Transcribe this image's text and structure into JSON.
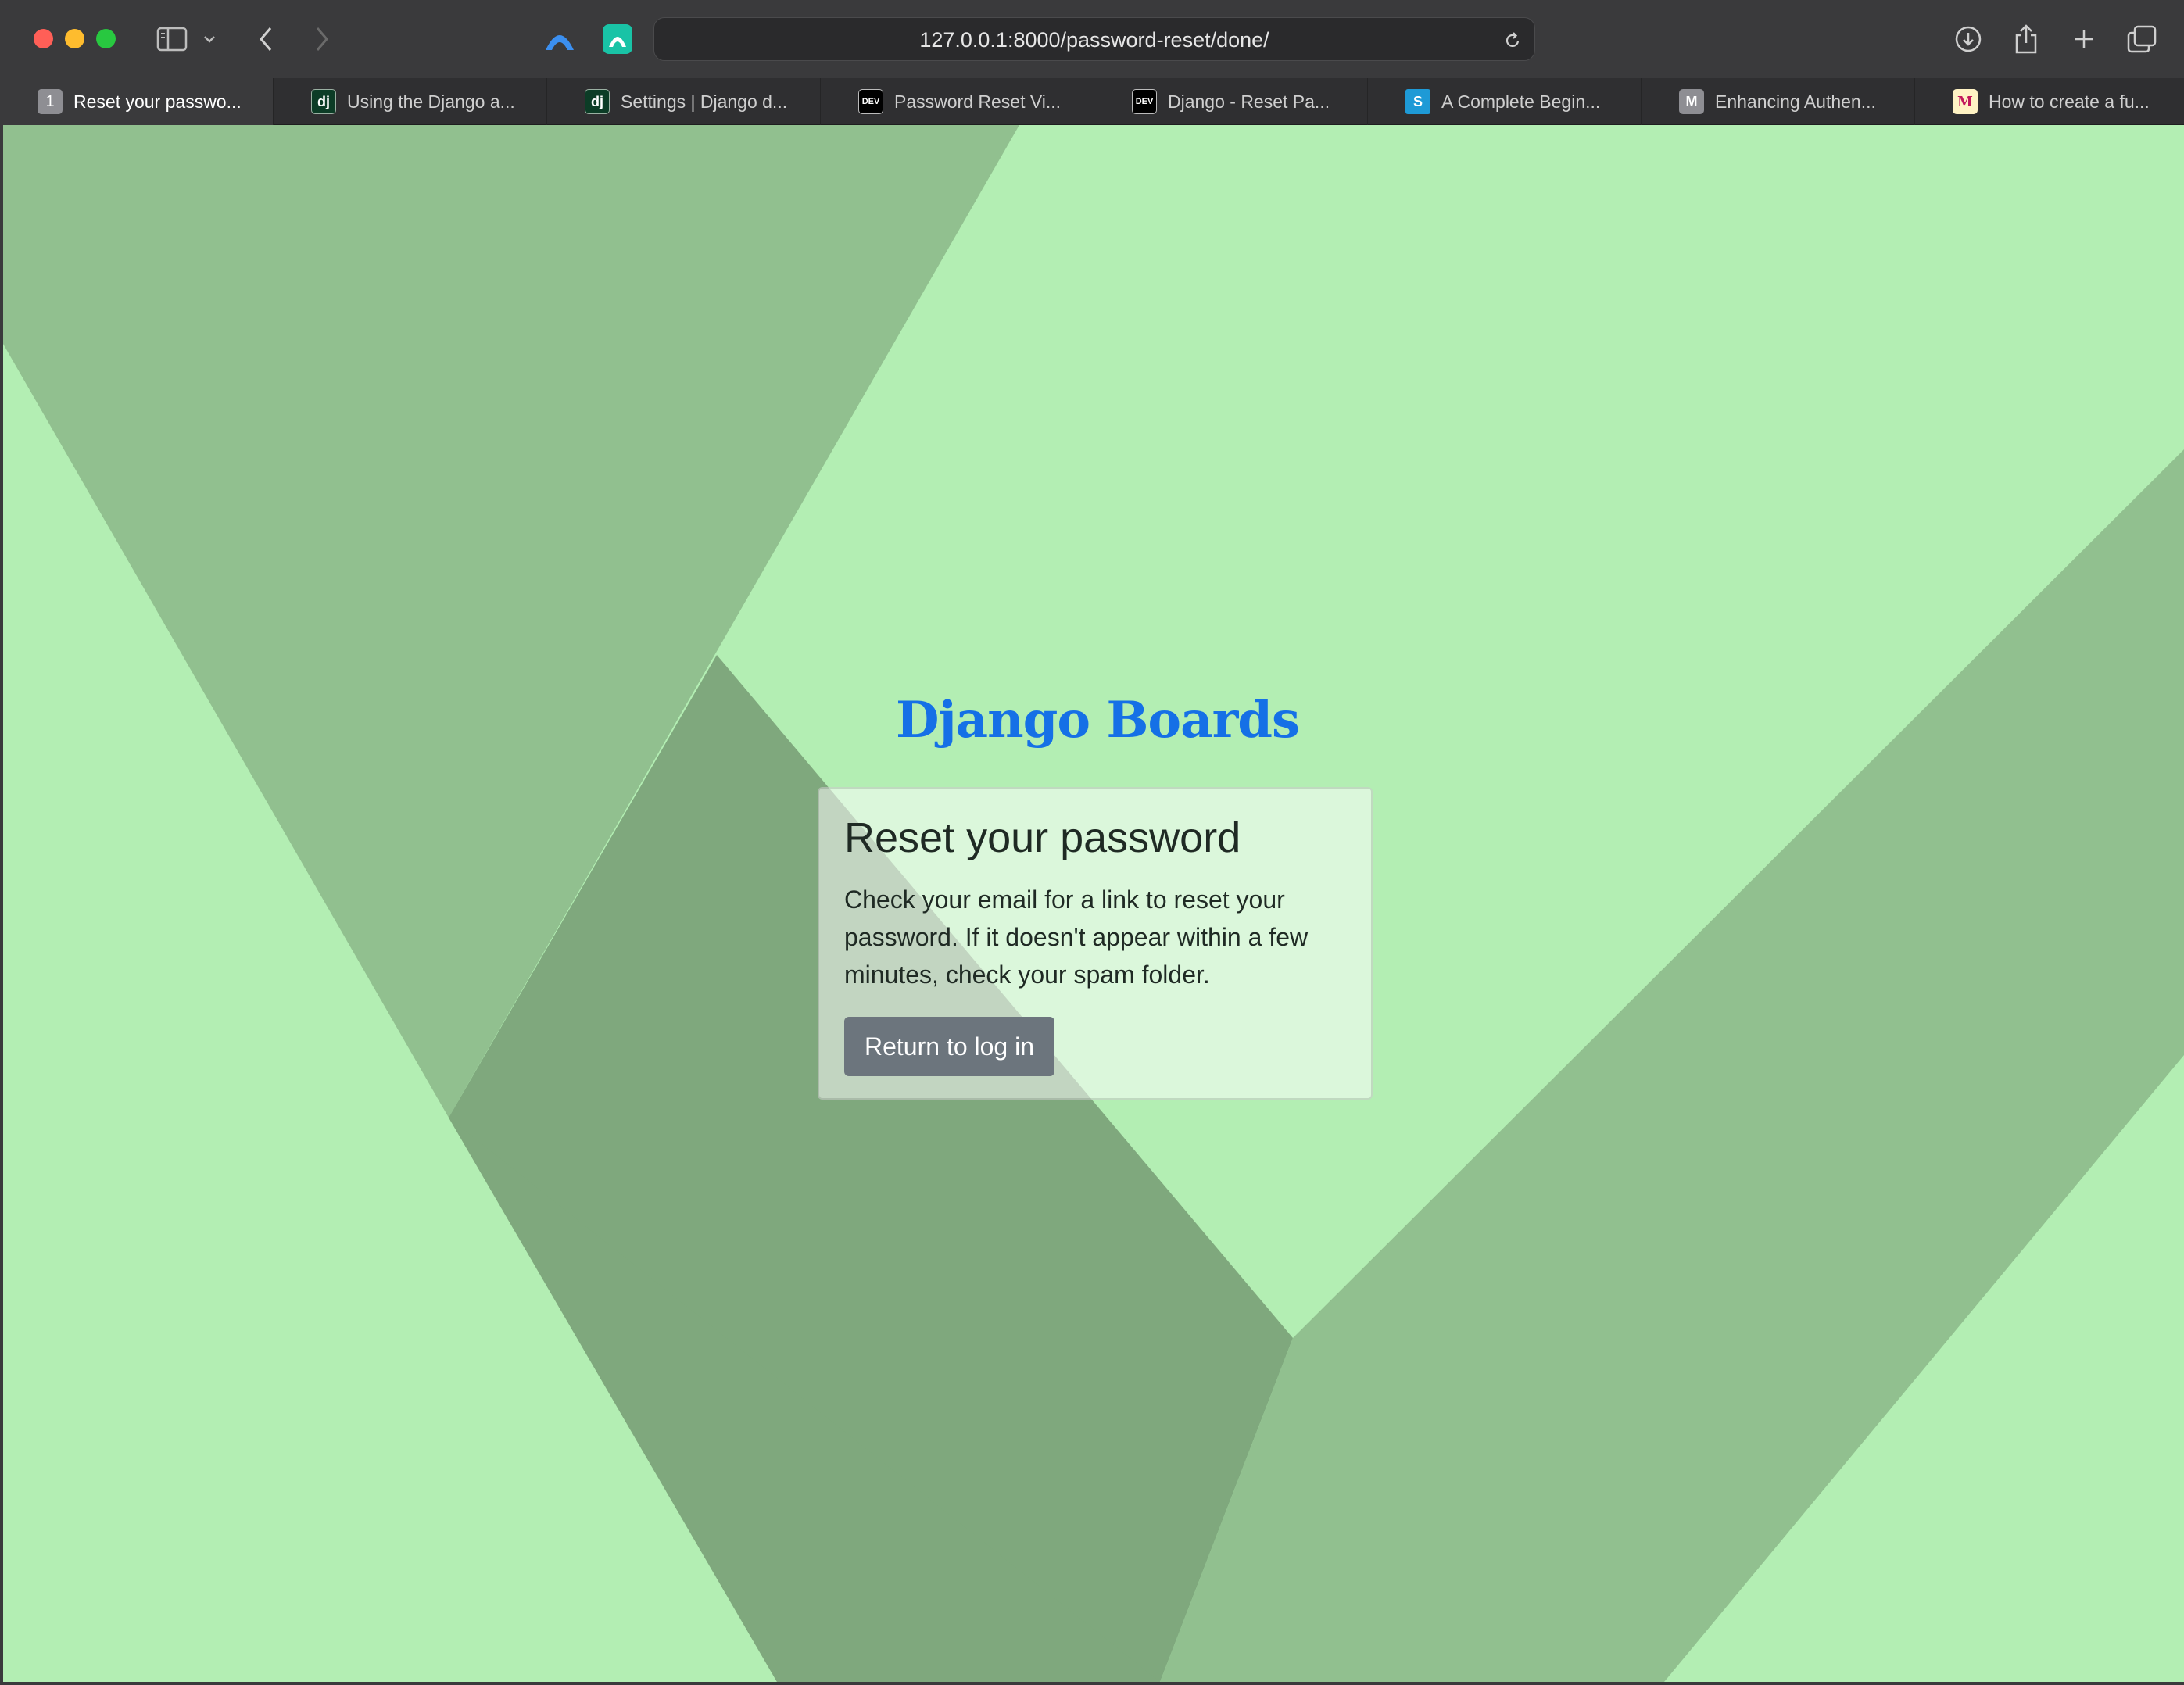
{
  "browser": {
    "url": "127.0.0.1:8000/password-reset/done/",
    "tabs": [
      {
        "favicon": "1",
        "label": "Reset your passwo..."
      },
      {
        "favicon": "dj",
        "label": "Using the Django a..."
      },
      {
        "favicon": "dj",
        "label": "Settings | Django d..."
      },
      {
        "favicon": "DEV",
        "label": "Password Reset Vi..."
      },
      {
        "favicon": "DEV",
        "label": "Django - Reset Pa..."
      },
      {
        "favicon": "S",
        "label": "A Complete Begin..."
      },
      {
        "favicon": "M",
        "label": "Enhancing Authen..."
      },
      {
        "favicon": "M",
        "label": "How to create a fu..."
      }
    ]
  },
  "page": {
    "logo": "Django Boards",
    "card": {
      "title": "Reset your password",
      "text": "Check your email for a link to reset your password. If it doesn't appear within a few minutes, check your spam folder.",
      "button_label": "Return to log in"
    }
  },
  "colors": {
    "page_background": "#b3eeb3",
    "logo": "#1570e6",
    "button": "#6c757d"
  }
}
